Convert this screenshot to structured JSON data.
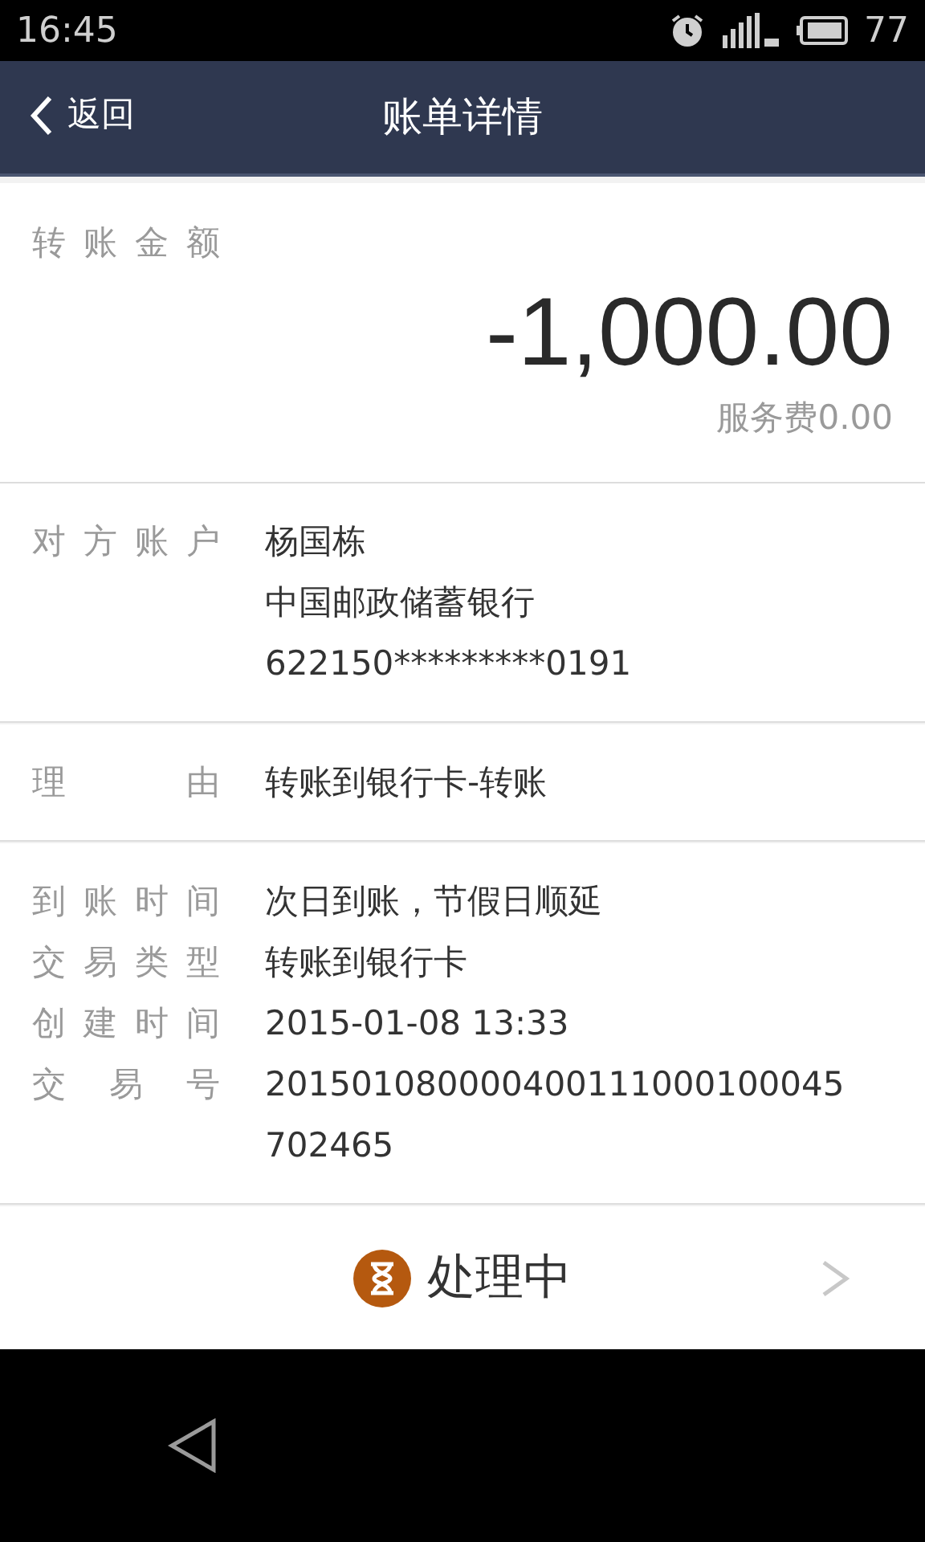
{
  "status_bar": {
    "time": "16:45",
    "battery": "77"
  },
  "header": {
    "back": "返回",
    "title": "账单详情"
  },
  "amount": {
    "label": "转账金额",
    "value": "-1,000.00",
    "fee": "服务费0.00"
  },
  "sections": [
    {
      "rows": [
        {
          "label": "对方账户",
          "lines": [
            "杨国栋",
            "中国邮政储蓄银行",
            "622150*********0191"
          ]
        }
      ]
    },
    {
      "rows": [
        {
          "label": "理由",
          "lines": [
            "转账到银行卡-转账"
          ]
        }
      ]
    },
    {
      "rows": [
        {
          "label": "到账时间",
          "lines": [
            "次日到账，节假日顺延"
          ]
        },
        {
          "label": "交易类型",
          "lines": [
            "转账到银行卡"
          ]
        },
        {
          "label": "创建时间",
          "lines": [
            "2015-01-08 13:33"
          ]
        },
        {
          "label": "交易号",
          "lines": [
            "201501080000400111000100045",
            "702465"
          ]
        }
      ]
    }
  ],
  "status": {
    "label": "处理中"
  }
}
